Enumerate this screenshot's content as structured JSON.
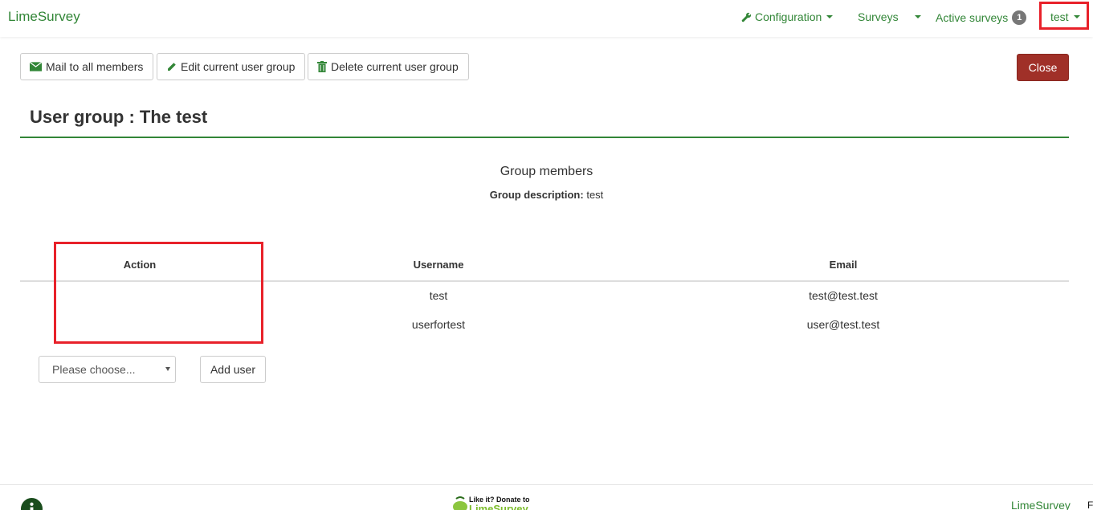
{
  "navbar": {
    "brand": "LimeSurvey",
    "configuration_label": "Configuration",
    "surveys_label": "Surveys",
    "active_surveys_label": "Active surveys",
    "active_surveys_count": "1",
    "user_label": "test",
    "accent_color": "#328637",
    "highlight_color": "#e8212a"
  },
  "toolbar": {
    "mail_label": "Mail to all members",
    "edit_label": "Edit current user group",
    "delete_label": "Delete current user group",
    "close_label": "Close",
    "close_color": "#a03028"
  },
  "page": {
    "title": "User group : The test",
    "section_title": "Group members",
    "description_label": "Group description:",
    "description_value": "test"
  },
  "table": {
    "headers": [
      "Action",
      "Username",
      "Email"
    ],
    "rows": [
      {
        "action": "",
        "username": "test",
        "email": "test@test.test"
      },
      {
        "action": "",
        "username": "userfortest",
        "email": "user@test.test"
      }
    ]
  },
  "add_user": {
    "select_value": "Please choose...",
    "button_label": "Add user"
  },
  "footer": {
    "donate_line1": "Like it? Donate to",
    "donate_line2": "LimeSurvey",
    "right_label": "LimeSurvey",
    "edge_text": "F"
  }
}
